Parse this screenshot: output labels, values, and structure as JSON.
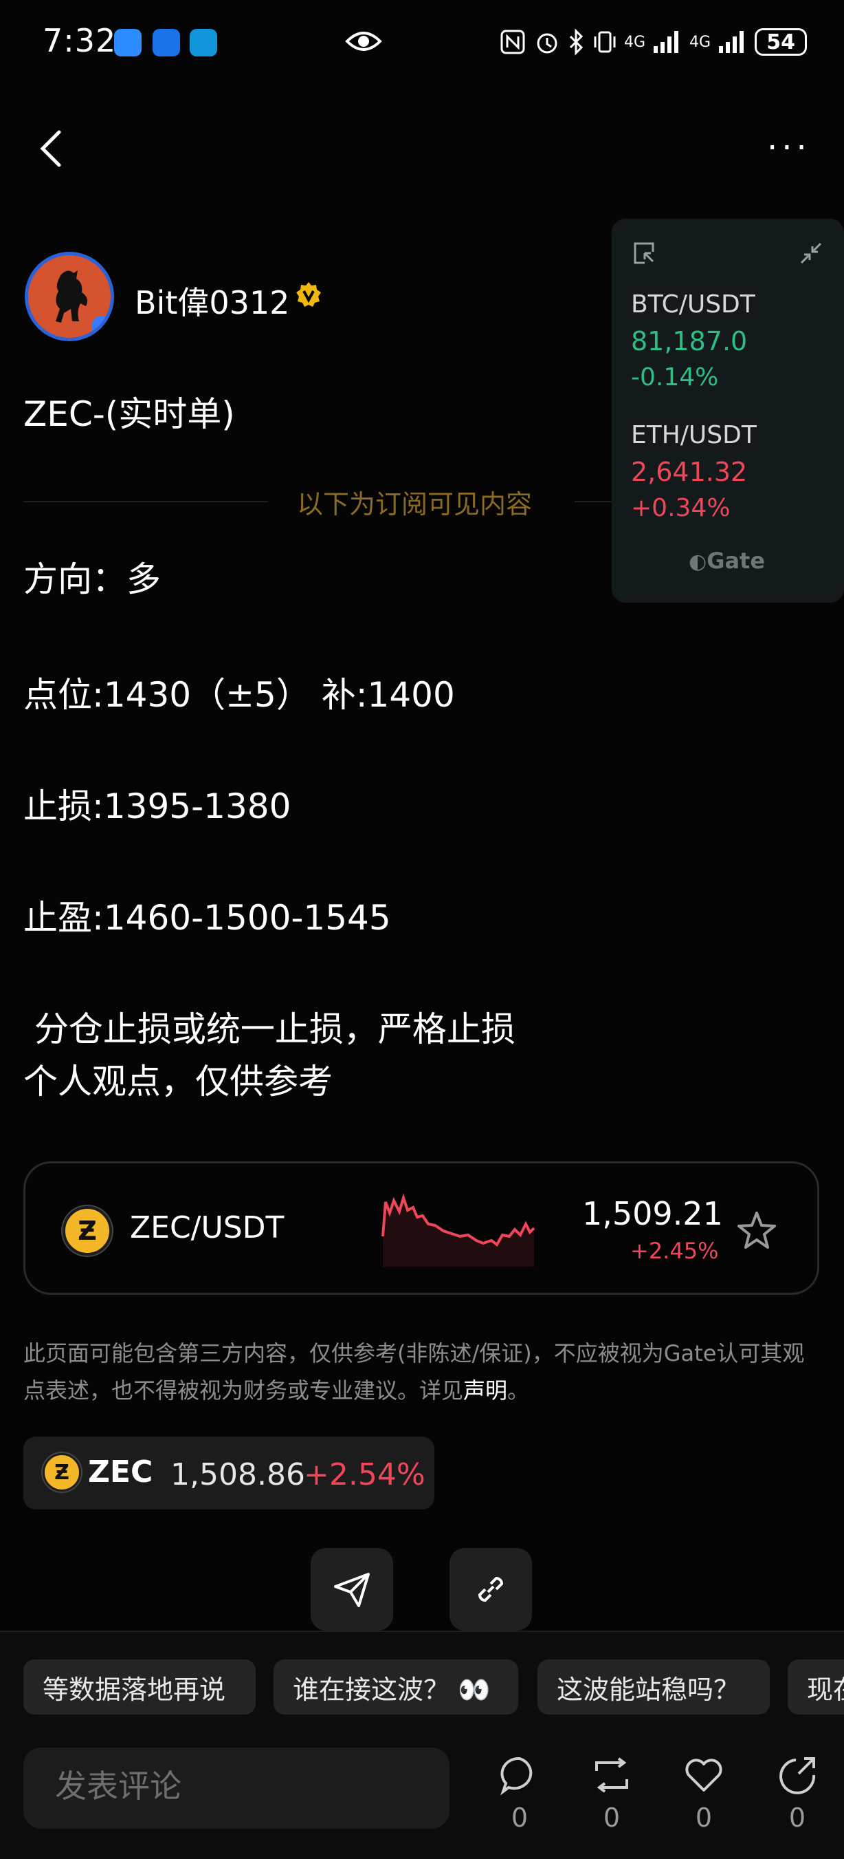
{
  "status_bar": {
    "time": "7:32",
    "battery": "54",
    "signal1": "4G",
    "signal2": "4G"
  },
  "nav": {
    "back_icon": "chevron-left-icon",
    "more_label": "···"
  },
  "author": {
    "name": "Bit偉0312",
    "verified": true
  },
  "post": {
    "title": "ZEC-(实时单)",
    "subscribe_divider": "以下为订阅可见内容",
    "direction": "方向：多",
    "entry": "点位:1430（±5） 补:1400",
    "stop_loss": "止损:1395-1380",
    "take_profit": "止盈:1460-1500-1545",
    "note1": " 分仓止损或统一止损，严格止损",
    "note2": "个人观点，仅供参考"
  },
  "ticker": {
    "items": [
      {
        "pair": "BTC/USDT",
        "price": "81,187.0",
        "change": "-0.14%"
      },
      {
        "pair": "ETH/USDT",
        "price": "2,641.32",
        "change": "+0.34%"
      }
    ],
    "brand": "Gate"
  },
  "token_card": {
    "pair": "ZEC/USDT",
    "price": "1,509.21",
    "change": "+2.45%",
    "icon": "zcash-icon"
  },
  "disclaimer": {
    "text": "此页面可能包含第三方内容，仅供参考(非陈述/保证)，不应被视为Gate认可其观点表述，也不得被视为财务或专业建议。详见",
    "link": "声明",
    "end": "。"
  },
  "coin_chip": {
    "symbol": "ZEC",
    "price": "1,508.86",
    "change": "+2.54%"
  },
  "quick_replies": [
    "等数据落地再说",
    "谁在接这波？ 👀",
    "这波能站稳吗？",
    "现在"
  ],
  "comment": {
    "placeholder": "发表评论"
  },
  "actions": [
    {
      "icon": "comment-icon",
      "count": "0"
    },
    {
      "icon": "repost-icon",
      "count": "0"
    },
    {
      "icon": "heart-icon",
      "count": "0"
    },
    {
      "icon": "share-icon",
      "count": "0"
    }
  ],
  "colors": {
    "up": "#f0465a",
    "down_green": "#2ebd85",
    "accent_gold": "#8a6a22"
  }
}
